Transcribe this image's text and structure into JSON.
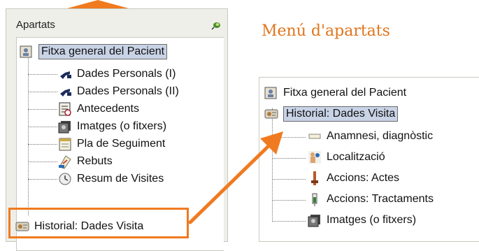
{
  "left_panel": {
    "title": "Apartats",
    "root": "Fitxa general del Pacient",
    "items": [
      {
        "label": "Dades Personals (I)",
        "icon": "pointing-hand-icon"
      },
      {
        "label": "Dades Personals (II)",
        "icon": "pointing-hand-icon"
      },
      {
        "label": "Antecedents",
        "icon": "clipboard-icon"
      },
      {
        "label": "Imatges (o fitxers)",
        "icon": "images-icon"
      },
      {
        "label": "Pla de Seguiment",
        "icon": "calendar-icon"
      },
      {
        "label": "Rebuts",
        "icon": "receipt-icon"
      },
      {
        "label": "Resum de Visites",
        "icon": "clock-icon"
      }
    ],
    "highlighted": "Historial: Dades Visita"
  },
  "menu_title": "Menú d'apartats",
  "right_panel": {
    "root": "Fitxa general del Pacient",
    "selected": "Historial: Dades Visita",
    "items": [
      {
        "label": "Anamnesi, diagnòstic",
        "icon": "note-icon"
      },
      {
        "label": "Localització",
        "icon": "body-locator-icon"
      },
      {
        "label": "Accions: Actes",
        "icon": "instrument-icon"
      },
      {
        "label": "Accions: Tractaments",
        "icon": "syringe-icon"
      },
      {
        "label": "Imatges (o fitxers)",
        "icon": "images-icon"
      }
    ]
  },
  "colors": {
    "accent": "#f07a20",
    "selection": "#c9d3e6"
  }
}
